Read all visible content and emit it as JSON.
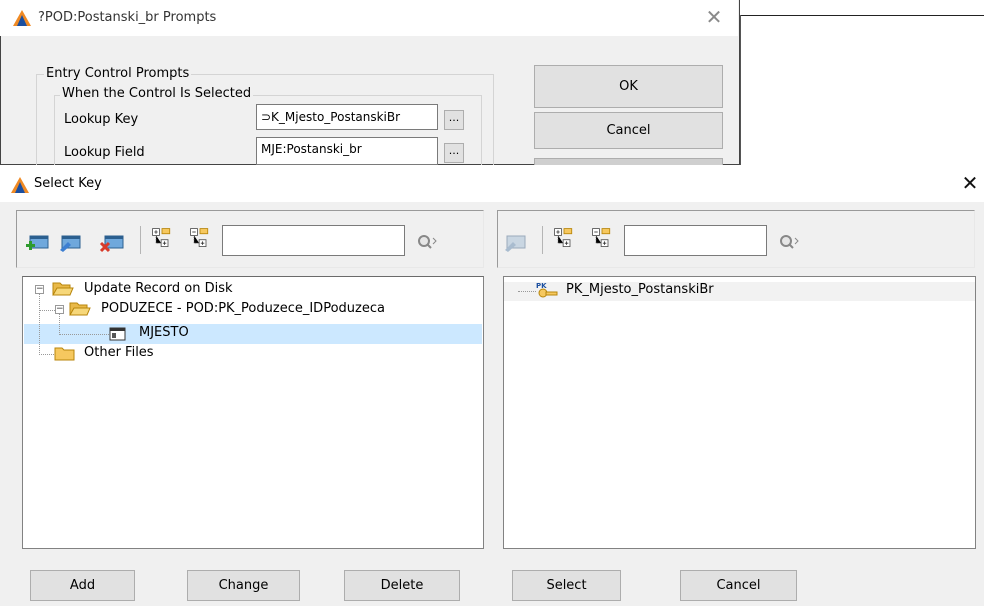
{
  "colors": {
    "dialog_bg": "#f0f0f0",
    "selection": "#cce8ff",
    "folder": "#f6c85f",
    "app_icon_orange": "#f08a24",
    "app_icon_blue": "#1b4fa0"
  },
  "prompts_dialog": {
    "title": "?POD:Postanski_br Prompts",
    "close_glyph": "✕",
    "entry_group_caption": "Entry Control Prompts",
    "selected_group_caption": "When the Control Is Selected",
    "lookup_key_label": "Lookup Key",
    "lookup_key_value": "⊃K_Mjesto_PostanskiBr",
    "lookup_field_label": "Lookup Field",
    "lookup_field_value": "MJE:Postanski_br",
    "browse_label": "...",
    "ok_label": "OK",
    "cancel_label": "Cancel"
  },
  "select_key_dialog": {
    "title": "Select Key",
    "close_glyph": "✕",
    "left_toolbar": {
      "icons": [
        "add-record-icon",
        "edit-record-icon",
        "delete-record-icon",
        "expand-all-icon",
        "collapse-all-icon",
        "find-icon"
      ],
      "search_value": ""
    },
    "right_toolbar": {
      "icons": [
        "edit-key-icon",
        "expand-all-icon",
        "collapse-all-icon",
        "find-icon"
      ],
      "search_value": ""
    },
    "tree": [
      {
        "label": "Update Record on Disk",
        "expanded": true,
        "type": "folder"
      },
      {
        "label": "PODUZECE - POD:PK_Poduzece_IDPoduzeca",
        "expanded": true,
        "type": "folder"
      },
      {
        "label": "MJESTO",
        "type": "table",
        "selected": true
      },
      {
        "label": "Other Files",
        "type": "folder"
      }
    ],
    "keys": [
      {
        "label": "PK_Mjesto_PostanskiBr",
        "badge": "PK",
        "type": "key"
      }
    ],
    "buttons": {
      "add": "Add",
      "change": "Change",
      "delete": "Delete",
      "select": "Select",
      "cancel": "Cancel"
    }
  }
}
